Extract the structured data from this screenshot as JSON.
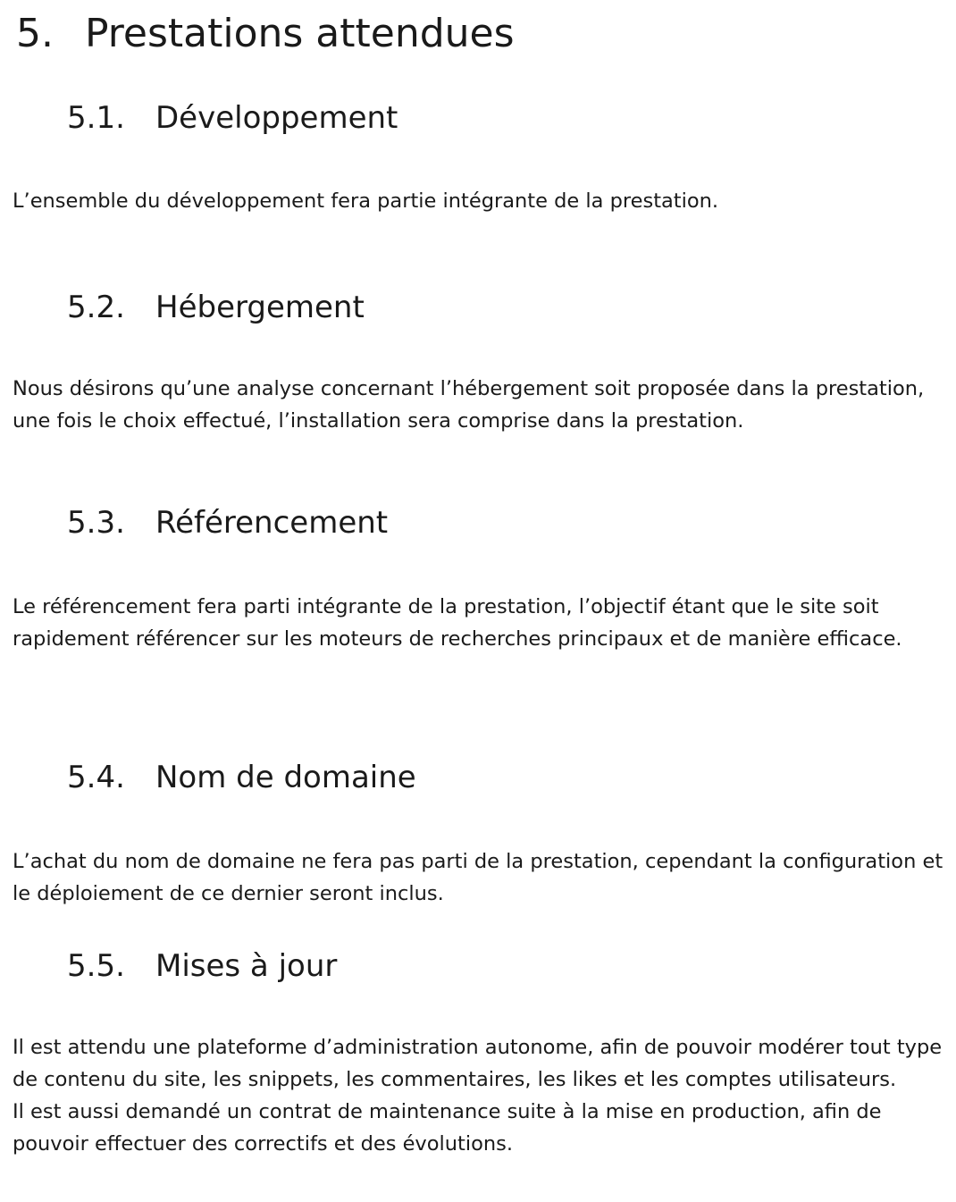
{
  "title": {
    "number": "5.",
    "text": "Prestations attendues"
  },
  "sections": [
    {
      "number": "5.1.",
      "heading": "Développement",
      "paragraphs": [
        "L’ensemble du développement fera partie intégrante de la prestation."
      ]
    },
    {
      "number": "5.2.",
      "heading": "Hébergement",
      "paragraphs": [
        "Nous désirons qu’une analyse concernant l’hébergement soit proposée dans la prestation, une fois le choix effectué, l’installation sera comprise dans la prestation."
      ]
    },
    {
      "number": "5.3.",
      "heading": "Référencement",
      "paragraphs": [
        "Le référencement fera parti intégrante de la prestation, l’objectif étant que le site soit rapidement référencer sur les moteurs de recherches principaux et de manière efficace."
      ]
    },
    {
      "number": "5.4.",
      "heading": "Nom de domaine",
      "paragraphs": [
        "L’achat du nom de domaine ne fera pas parti de la prestation, cependant la configuration et le déploiement de ce dernier seront inclus."
      ]
    },
    {
      "number": "5.5.",
      "heading": "Mises à jour",
      "paragraphs": [
        "Il est attendu une plateforme d’administration autonome, afin de pouvoir modérer tout type de contenu du site, les snippets, les commentaires, les likes et les comptes utilisateurs.",
        "Il est aussi demandé un contrat de maintenance suite à la mise en production, afin de pouvoir effectuer des correctifs et des évolutions."
      ]
    }
  ]
}
